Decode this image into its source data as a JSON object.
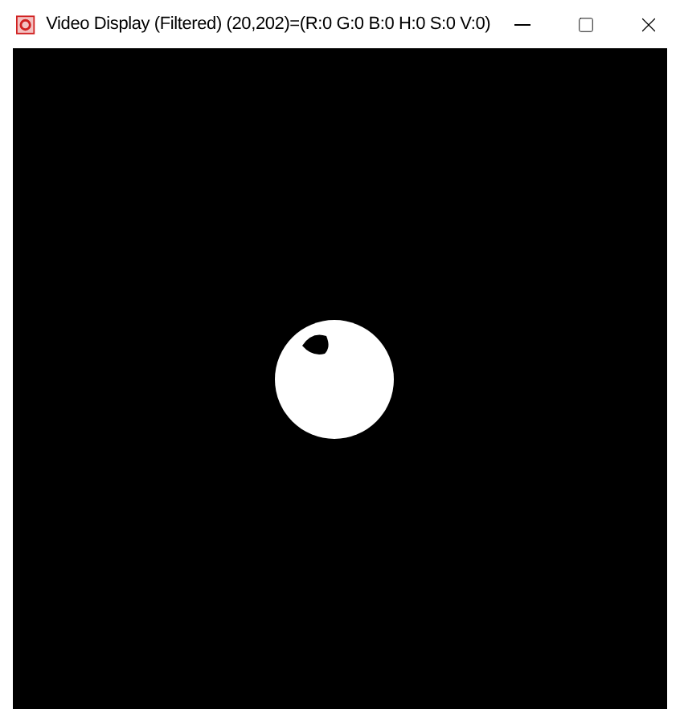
{
  "window": {
    "title": "Video Display (Filtered) (20,202)=(R:0 G:0 B:0 H:0 S:0 V:0)"
  }
}
